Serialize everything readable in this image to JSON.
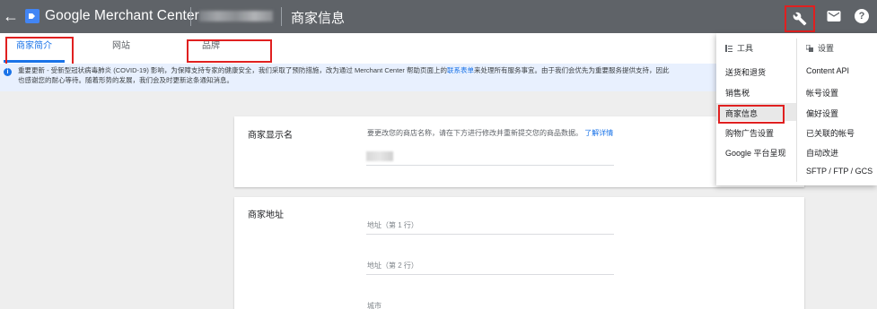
{
  "header": {
    "app_title": "Google Merchant Center",
    "page_title": "商家信息",
    "icons": [
      "back-arrow-icon",
      "merchant-center-logo-icon",
      "wrench-icon",
      "mail-icon",
      "help-icon"
    ],
    "help_glyph": "?"
  },
  "tabs": [
    {
      "label": "商家简介",
      "active": true
    },
    {
      "label": "网站",
      "active": false
    },
    {
      "label": "品牌",
      "active": false
    }
  ],
  "notice": {
    "prefix": "重要更新 - 受新型冠状病毒肺炎 (COVID-19) 影响，为保障支持专家的健康安全，我们采取了预防措施，改为通过 Merchant Center 帮助页面上的",
    "link": "联系表单",
    "suffix": "来处理所有服务事宜。由于我们会优先为重要服务提供支持，因此",
    "line2": "也感谢您的耐心等待。随着形势的发展，我们会及时更新这条通知消息。"
  },
  "business_name_section": {
    "label": "商家显示名",
    "help_text": "要更改您的商店名称，请在下方进行修改并重新提交您的商品数据。",
    "help_link": "了解详情"
  },
  "address_section": {
    "label": "商家地址",
    "fields": [
      {
        "placeholder": "地址（第 1 行）"
      },
      {
        "placeholder": "地址（第 2 行）"
      },
      {
        "placeholder": "城市"
      }
    ]
  },
  "tools_menu": {
    "tools_heading": "工具",
    "settings_heading": "设置",
    "tools_items": [
      "送货和退货",
      "销售税",
      "商家信息",
      "购物广告设置",
      "Google 平台呈现"
    ],
    "settings_items": [
      "Content API",
      "帐号设置",
      "偏好设置",
      "已关联的帐号",
      "自动改进",
      "SFTP / FTP / GCS"
    ],
    "highlighted_item": "商家信息"
  },
  "colors": {
    "topbar": "#5f6368",
    "accent": "#1a73e8",
    "annotation_red": "#e02020",
    "notice_bg": "#e8f0fe"
  }
}
